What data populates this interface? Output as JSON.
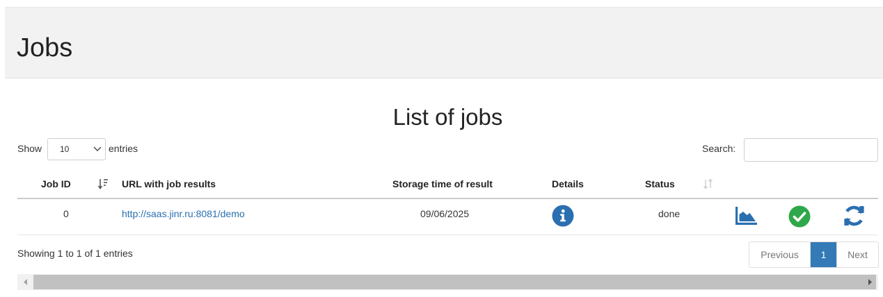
{
  "header": {
    "title": "Jobs"
  },
  "list": {
    "title": "List of jobs",
    "show_label": "Show",
    "length_value": "10",
    "entries_label": "entries",
    "search_label": "Search:",
    "search_value": ""
  },
  "table": {
    "columns": [
      "Job ID",
      "URL with job results",
      "Storage time of result",
      "Details",
      "Status"
    ],
    "rows": [
      {
        "job_id": "0",
        "url": "http://saas.jinr.ru:8081/demo",
        "storage_time": "09/06/2025",
        "details_icon": "info-circle-icon",
        "status": "done",
        "actions": [
          "area-chart-icon",
          "check-circle-icon",
          "refresh-icon"
        ]
      }
    ]
  },
  "footer": {
    "info": "Showing 1 to 1 of 1 entries",
    "pagination": {
      "previous": "Previous",
      "current": "1",
      "next": "Next"
    }
  },
  "colors": {
    "link": "#2a6fb0",
    "primary": "#337ab7",
    "success": "#2ea84a",
    "header_bg": "#f2f2f2"
  }
}
